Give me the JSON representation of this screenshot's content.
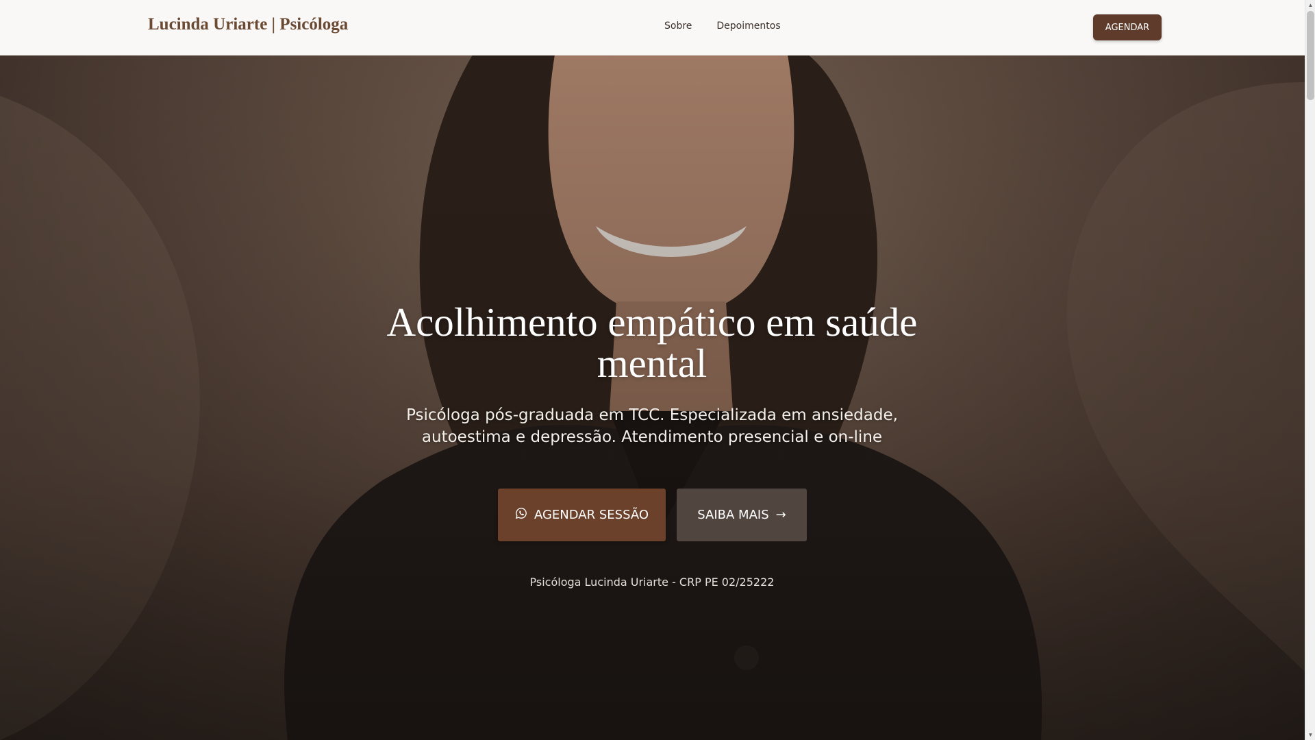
{
  "header": {
    "brand": "Lucinda Uriarte | Psicóloga",
    "nav": [
      {
        "label": "Sobre"
      },
      {
        "label": "Depoimentos"
      }
    ],
    "cta_label": "AGENDAR"
  },
  "hero": {
    "title": "Acolhimento empático em saúde mental",
    "subtitle": "Psicóloga pós-graduada em TCC. Especializada em ansiedade, autoestima e depressão. Atendimento presencial e on-line",
    "primary_button": {
      "label": "AGENDAR SESSÃO",
      "icon": "whatsapp-icon"
    },
    "secondary_button": {
      "label": "SAIBA MAIS",
      "icon": "arrow-right-icon"
    },
    "credit": "Psicóloga Lucinda Uriarte - CRP PE 02/25222"
  },
  "colors": {
    "brand": "#6b4a34",
    "primary_button": "#6b412c",
    "header_bg": "#faf8f6"
  },
  "icons": {
    "scroll_up": "▲",
    "scroll_down": "▼",
    "arrow_right": "→"
  }
}
